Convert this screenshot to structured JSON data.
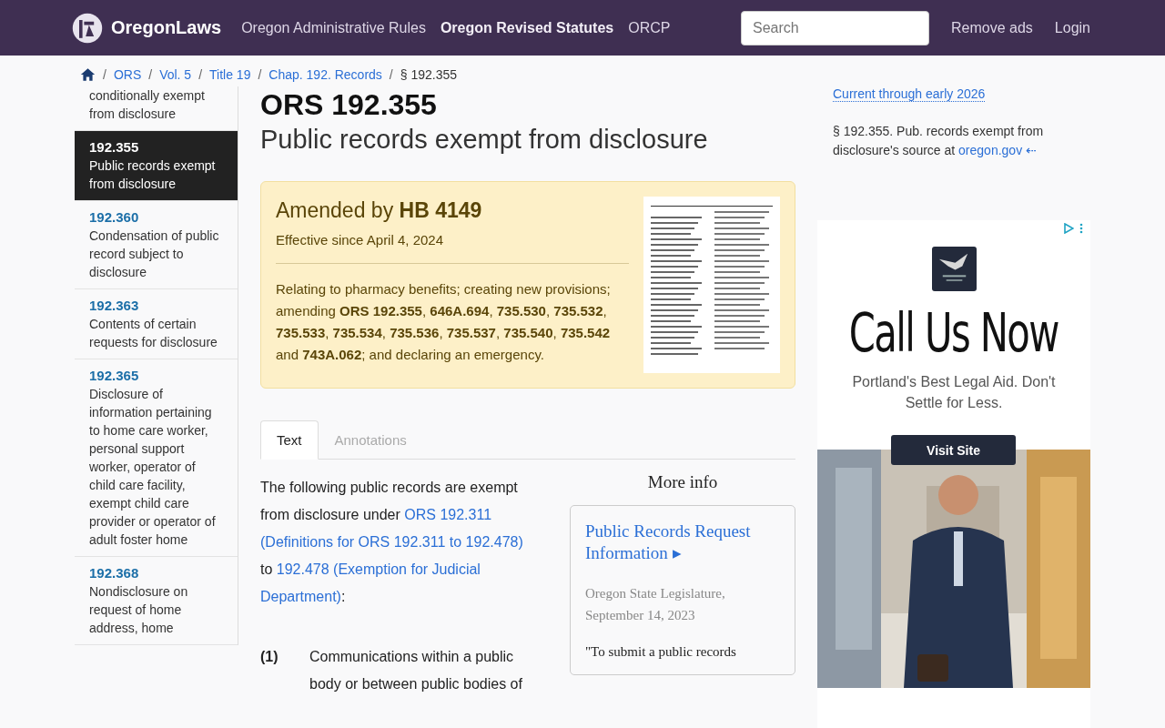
{
  "header": {
    "brand": "OregonLaws",
    "nav": [
      {
        "label": "Oregon Administrative Rules",
        "selected": false
      },
      {
        "label": "Oregon Revised Statutes",
        "selected": true
      },
      {
        "label": "ORCP",
        "selected": false
      }
    ],
    "search": {
      "placeholder": "Search"
    },
    "links": [
      "Remove ads",
      "Login"
    ]
  },
  "breadcrumb": {
    "items": [
      "ORS",
      "Vol. 5",
      "Title 19",
      "Chap. 192. Records"
    ],
    "current": "§ 192.355",
    "separator": "/"
  },
  "sidebar": {
    "items": [
      {
        "title": "conditionally exempt from disclosure",
        "selected": false
      },
      {
        "number": "192.355",
        "title": "Public records exempt from disclosure",
        "selected": true
      },
      {
        "number": "192.360",
        "title": "Condensation of public record subject to disclosure",
        "selected": false
      },
      {
        "number": "192.363",
        "title": "Contents of certain requests for disclosure",
        "selected": false
      },
      {
        "number": "192.365",
        "title": "Disclosure of information pertaining to home care worker, personal support worker, operator of child care facility, exempt child care provider or operator of adult foster home",
        "selected": false
      },
      {
        "number": "192.368",
        "title": "Nondisclosure on request of home address, home",
        "selected": false
      }
    ]
  },
  "main": {
    "title": "ORS 192.355",
    "subtitle": "Public records exempt from disclosure",
    "amendment": {
      "heading": "Amended by **HB 4149**",
      "effective": "Effective since April 4, 2024",
      "description": "Relating to pharmacy benefits; creating new provisions; amending **ORS 192.355**, **646A.694**, **735.530**, **735.532**, **735.533**, **735.534**, **735.536**, **735.537**, **735.540**, **735.542** and **743A.062**; and declaring an emergency."
    },
    "tabs": [
      {
        "label": "Text",
        "selected": true
      },
      {
        "label": "Annotations",
        "selected": false
      }
    ],
    "intro": [
      {
        "kind": "text",
        "text": "The following public records are exempt from disclosure under "
      },
      {
        "kind": "link",
        "text": "ORS 192.311"
      },
      {
        "kind": "space"
      },
      {
        "kind": "link",
        "text": "(Definitions for ORS 192.311 to 192.478)"
      },
      {
        "kind": "text",
        "text": " to "
      },
      {
        "kind": "link",
        "text": "192.478 (Exemption for Judicial"
      },
      {
        "kind": "space"
      },
      {
        "kind": "link",
        "text": "Department)"
      },
      {
        "kind": "text",
        "text": ":"
      }
    ],
    "subsections": [
      {
        "number": "(1)",
        "text": "Communications within a public body or between public bodies of"
      }
    ],
    "more_info": {
      "heading": "More info",
      "card_title": "Public Records Request Information ▸",
      "source": "Oregon State Legislature, September 14, 2023",
      "quote": "\"To submit a public records"
    }
  },
  "aside": {
    "current": "Current through early 2026",
    "source_text": "§ 192.355. Pub. records exempt from disclosure's source at ",
    "source_link": "oregon.gov ⇠",
    "ad": {
      "headline": "Call Us Now",
      "tagline": "Portland's Best Legal Aid. Don't Settle for Less.",
      "button": "Visit Site"
    }
  }
}
